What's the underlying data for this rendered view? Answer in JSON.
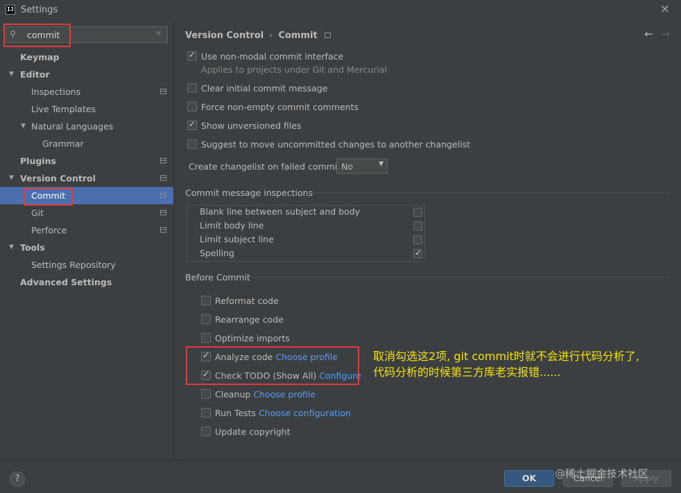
{
  "window": {
    "title": "Settings",
    "app_icon_text": "IJ"
  },
  "search": {
    "value": "commit"
  },
  "sidebar": {
    "items": [
      {
        "label": "Keymap"
      },
      {
        "label": "Editor"
      },
      {
        "label": "Inspections"
      },
      {
        "label": "Live Templates"
      },
      {
        "label": "Natural Languages"
      },
      {
        "label": "Grammar"
      },
      {
        "label": "Plugins"
      },
      {
        "label": "Version Control"
      },
      {
        "label": "Commit"
      },
      {
        "label": "Git"
      },
      {
        "label": "Perforce"
      },
      {
        "label": "Tools"
      },
      {
        "label": "Settings Repository"
      },
      {
        "label": "Advanced Settings"
      }
    ]
  },
  "breadcrumb": {
    "parent": "Version Control",
    "current": "Commit"
  },
  "options": {
    "non_modal": {
      "label": "Use non-modal commit interface",
      "checked": true
    },
    "non_modal_hint": "Applies to projects under Git and Mercurial",
    "clear_initial": {
      "label": "Clear initial commit message",
      "checked": false
    },
    "force_nonempty": {
      "label": "Force non-empty commit comments",
      "checked": false
    },
    "show_unversioned": {
      "label": "Show unversioned files",
      "checked": true
    },
    "suggest_move": {
      "label": "Suggest to move uncommitted changes to another changelist",
      "checked": false
    },
    "create_changelist_label": "Create changelist on failed commit:",
    "create_changelist_value": "No"
  },
  "inspections": {
    "title": "Commit message inspections",
    "rows": [
      {
        "label": "Blank line between subject and body",
        "checked": false
      },
      {
        "label": "Limit body line",
        "checked": false
      },
      {
        "label": "Limit subject line",
        "checked": false
      },
      {
        "label": "Spelling",
        "checked": true
      }
    ]
  },
  "before_commit": {
    "title": "Before Commit",
    "items": [
      {
        "label": "Reformat code",
        "link": "",
        "checked": false
      },
      {
        "label": "Rearrange code",
        "link": "",
        "checked": false
      },
      {
        "label": "Optimize imports",
        "link": "",
        "checked": false
      },
      {
        "label": "Analyze code",
        "link": "Choose profile",
        "checked": true
      },
      {
        "label": "Check TODO (Show All)",
        "link": "Configure",
        "checked": true
      },
      {
        "label": "Cleanup",
        "link": "Choose profile",
        "checked": false
      },
      {
        "label": "Run Tests",
        "link": "Choose configuration",
        "checked": false
      },
      {
        "label": "Update copyright",
        "link": "",
        "checked": false
      }
    ]
  },
  "annotation": {
    "line1": "取消勾选这2项, git commit时就不会进行代码分析了,",
    "line2": "代码分析的时候第三方库老实报错......"
  },
  "footer": {
    "help": "?",
    "ok": "OK",
    "cancel": "Cancel",
    "apply": "Apply",
    "watermark": "@稀土掘金技术社区"
  },
  "colors": {
    "selection": "#4b6eaf",
    "link": "#589df6",
    "highlight": "#e03c3c",
    "annotation": "#f5e400"
  }
}
